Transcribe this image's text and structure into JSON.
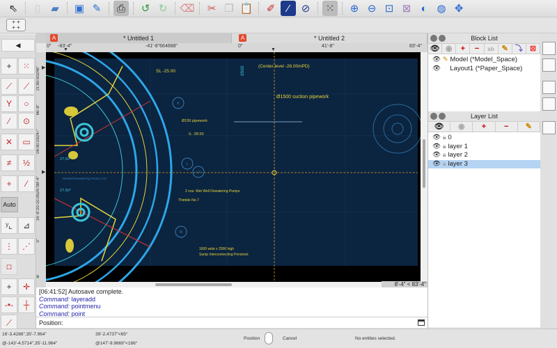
{
  "toolbar": {
    "icons": [
      "select-pointer-icon",
      "new-file-icon",
      "open-folder-icon",
      "save-icon",
      "save-as-icon",
      "print-preview-icon",
      "undo-icon",
      "redo-icon",
      "eraser-icon",
      "cut-icon",
      "copy-icon",
      "paste-icon",
      "pen-icon",
      "line-color-icon",
      "circle-slash-icon",
      "grid-icon",
      "zoom-in-icon",
      "zoom-out-icon",
      "zoom-auto-icon",
      "zoom-window-icon",
      "zoom-previous-icon",
      "zoom-redraw-icon",
      "pan-icon"
    ]
  },
  "tabs": [
    {
      "label": "* Untitled 1"
    },
    {
      "label": "* Untitled 2"
    }
  ],
  "ruler": {
    "tab1": [
      "0\"",
      "-83'-4\"",
      "-41'-8\"664688\""
    ],
    "tab2": [
      "0\"",
      "41'-8\"",
      "83'-4\""
    ],
    "vertical": [
      "21'80-90248\"",
      "66'-8\"",
      "08-90.09247\"",
      "16'-8\"20-10.0624788'-4\"",
      "0\"",
      "le"
    ]
  },
  "left_toolbar": {
    "back_label": "◀",
    "auto_label": "Auto"
  },
  "drawing": {
    "labels": [
      "(Center level -28.00mPD)",
      "SL -25.00",
      "6500",
      "Ø1500 suction pipework",
      "Ø150 pipework",
      "IL -28.50",
      "27.50°",
      "27.50°",
      "Wetwell Dewatering Pump LCS",
      "2 nos. Wet Well Dewatering Pumps",
      "Thimble No.7",
      "1600 wide x 2500 high",
      "Sump Interconnecting Penstock",
      "K",
      "L",
      "L2",
      "M"
    ]
  },
  "scroll_readout": "8'-4\" < 83'-4\"",
  "command": {
    "lines": [
      {
        "prefix": "",
        "text": "[06:41:52] Autosave complete."
      },
      {
        "prefix": "Command:",
        "text": " layeradd"
      },
      {
        "prefix": "Command:",
        "text": " pointmenu"
      },
      {
        "prefix": "Command:",
        "text": " point"
      }
    ],
    "position_label": "Position:"
  },
  "block_list": {
    "title": "Block List",
    "items": [
      {
        "label": "Model (*Model_Space)"
      },
      {
        "label": "Layout1 (*Paper_Space)"
      }
    ]
  },
  "layer_list": {
    "title": "Layer List",
    "items": [
      {
        "label": "0"
      },
      {
        "label": "layer 1"
      },
      {
        "label": "layer 2"
      },
      {
        "label": "layer 3"
      }
    ],
    "selected": "layer 3"
  },
  "status": {
    "abs_coord": "16'-3.4286\",35'-7.964\"",
    "rel_coord": "@-143'-4.5714\",35'-11.964\"",
    "polar": "39'-2.4737\"<65°",
    "rel_polar": "@147'-9.9669\"<166°",
    "mouse_left": "Position",
    "mouse_right": "Cancel",
    "selection": "No entities selected."
  },
  "colors": {
    "canvas": "#0b2440",
    "selection": "#b5d4f4",
    "accent": "#e2492d"
  }
}
